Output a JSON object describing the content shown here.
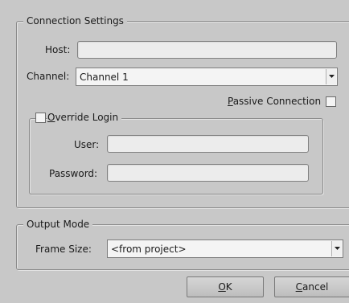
{
  "connection": {
    "title": "Connection Settings",
    "host_label": "Host:",
    "host_value": "",
    "channel_label": "Channel:",
    "channel_value": "Channel 1",
    "passive_label": "Passive Connection",
    "passive_mnemonic": "P",
    "passive_rest": "assive Connection",
    "passive_checked": false
  },
  "override": {
    "title": "Override Login",
    "title_mnemonic": "O",
    "title_rest": "verride Login",
    "checked": false,
    "user_label": "User:",
    "user_value": "",
    "password_label": "Password:",
    "password_value": ""
  },
  "output": {
    "title": "Output Mode",
    "frame_size_label": "Frame Size:",
    "frame_size_value": "<from project>"
  },
  "buttons": {
    "ok_label": "OK",
    "ok_mnemonic": "O",
    "ok_rest": "K",
    "cancel_label": "Cancel",
    "cancel_mnemonic": "C",
    "cancel_rest": "ancel"
  },
  "colors": {
    "background": "#c8c8c8",
    "field": "#ececec",
    "border": "#8a8a8a"
  }
}
